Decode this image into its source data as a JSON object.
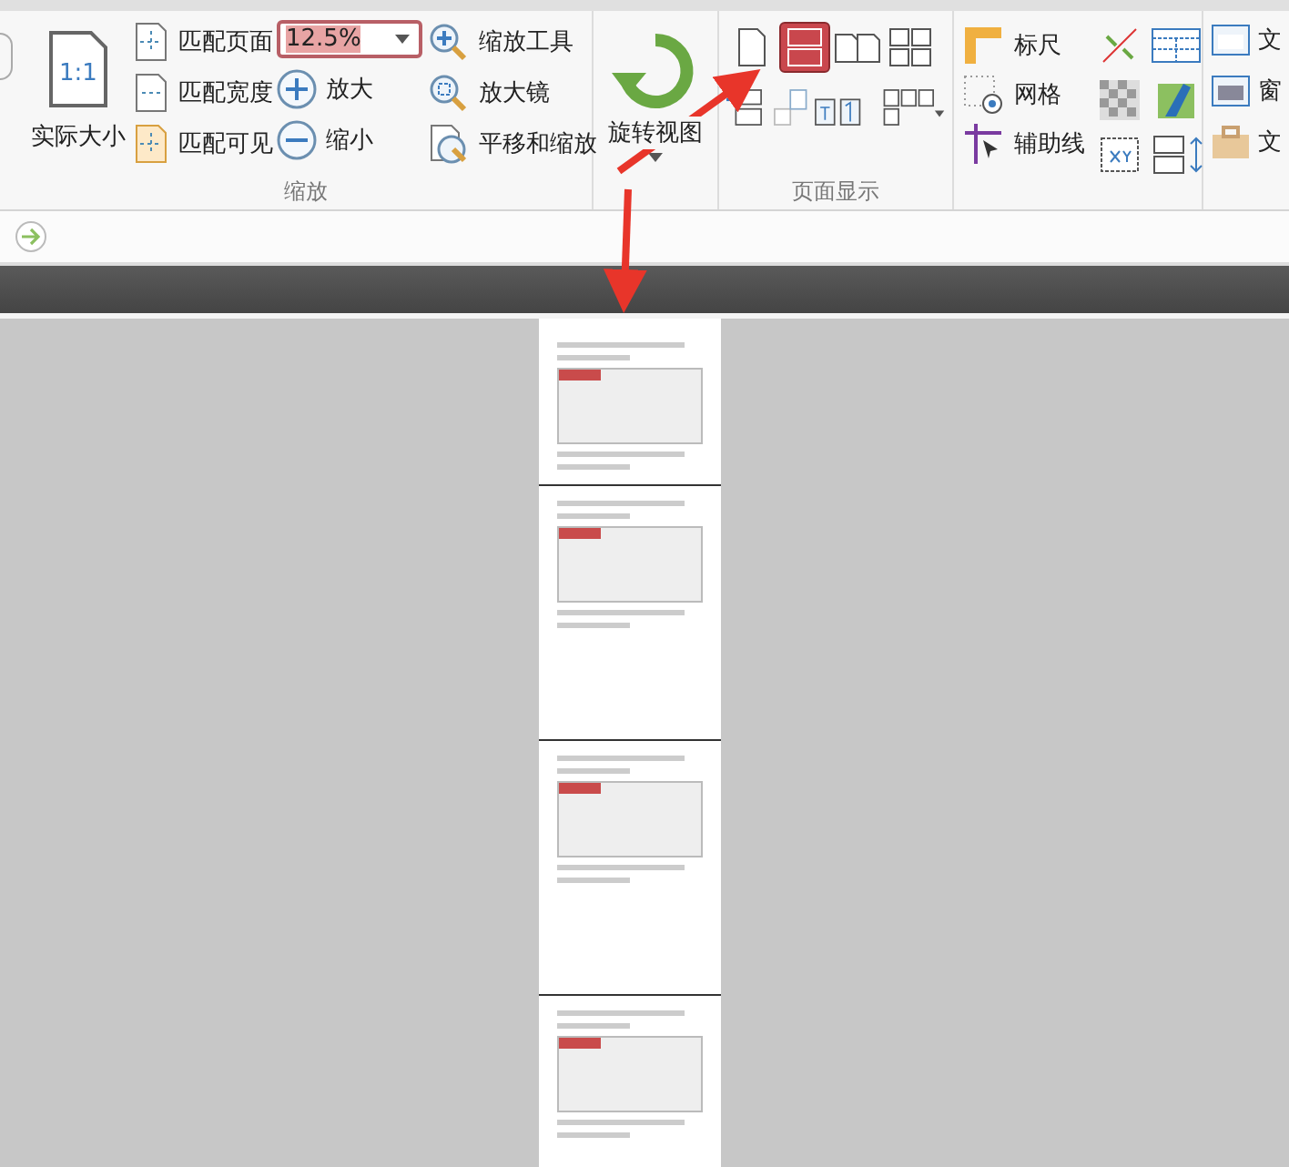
{
  "ribbon": {
    "zoom_group": {
      "label": "缩放",
      "actual_size": "实际大小",
      "actual_size_icon_text": "1:1",
      "fit_buttons": [
        {
          "label": "匹配页面",
          "kind": "page"
        },
        {
          "label": "匹配宽度",
          "kind": "width"
        },
        {
          "label": "匹配可见",
          "kind": "visible"
        }
      ],
      "zoom_field": {
        "value": "12.5%"
      },
      "zoom_buttons": [
        {
          "label": "放大",
          "kind": "in"
        },
        {
          "label": "缩小",
          "kind": "out"
        }
      ],
      "tools": [
        {
          "label": "缩放工具",
          "kind": "zoom"
        },
        {
          "label": "放大镜",
          "kind": "loupe"
        },
        {
          "label": "平移和缩放",
          "kind": "pan"
        }
      ]
    },
    "rotate": {
      "label": "旋转视图"
    },
    "page_display": {
      "label": "页面显示",
      "layouts": [
        {
          "kind": "single",
          "selected": false
        },
        {
          "kind": "continuous",
          "selected": true
        },
        {
          "kind": "facing",
          "selected": false
        },
        {
          "kind": "continuous_facing",
          "selected": false
        }
      ]
    },
    "view_tools": [
      {
        "label": "标尺",
        "kind": "ruler"
      },
      {
        "label": "网格",
        "kind": "grid"
      },
      {
        "label": "辅助线",
        "kind": "guide"
      }
    ],
    "cut_items": [
      "文",
      "窗",
      "文"
    ]
  }
}
